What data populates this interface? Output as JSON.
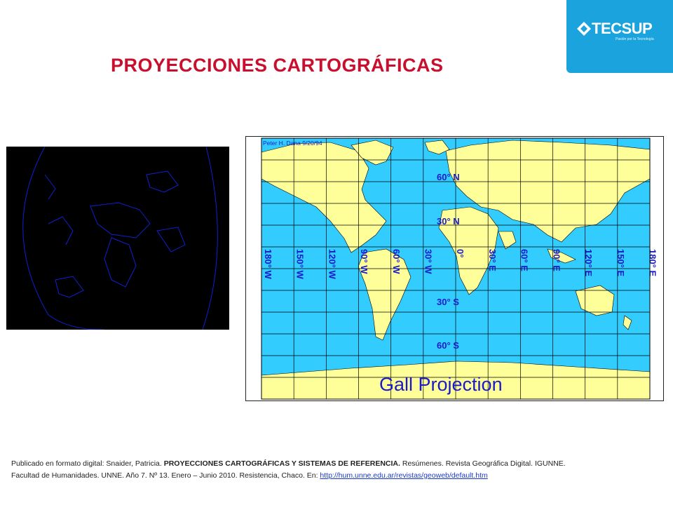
{
  "logo": {
    "brand": "TECSUP",
    "tagline": "Pasión por la Tecnología"
  },
  "slide": {
    "title": "PROYECCIONES  CARTOGRÁFICAS"
  },
  "gall_map": {
    "credit": "Peter H. Dana 9/20/94",
    "caption": "Gall Projection",
    "latitude_labels": [
      "60° N",
      "30° N",
      "30° S",
      "60° S"
    ],
    "longitude_labels": [
      "180° W",
      "150° W",
      "120° W",
      "90° W",
      "60° W",
      "30° W",
      "0°",
      "30° E",
      "60° E",
      "90° E",
      "120° E",
      "150° E",
      "180° E"
    ]
  },
  "citation": {
    "prefix": "Publicado en formato digital: Snaider, Patricia.",
    "bold": "PROYECCIONES CARTOGRÁFICAS Y SISTEMAS DE REFERENCIA.",
    "rest_line1": "Resúmenes. Revista Geográfica Digital. IGUNNE.",
    "line2": "Facultad de Humanidades. UNNE. Año 7. Nº 13. Enero – Junio 2010. Resistencia, Chaco. En:",
    "link": "http://hum.unne.edu.ar/revistas/geoweb/default.htm"
  },
  "colors": {
    "title": "#c8102e",
    "logo_bg": "#1aa3dc",
    "ocean": "#33ccff",
    "land": "#ffff99",
    "grid_label": "#1a1acc",
    "globe_line": "#1020d0"
  }
}
